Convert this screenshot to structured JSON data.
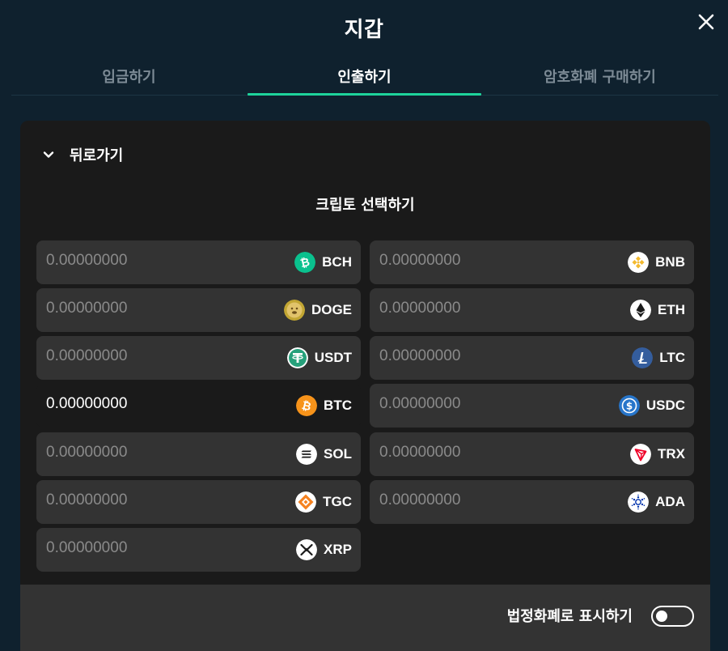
{
  "dialog": {
    "title": "지갑"
  },
  "tabs": [
    {
      "label": "입금하기",
      "active": false
    },
    {
      "label": "인출하기",
      "active": true
    },
    {
      "label": "암호화폐 구매하기",
      "active": false
    }
  ],
  "back": {
    "label": "뒤로가기"
  },
  "section_title": "크립토 선택하기",
  "currencies_left": [
    {
      "amount": "0.00000000",
      "code": "BCH",
      "icon": "bitcoin-cash-icon",
      "color": "#0ac18e"
    },
    {
      "amount": "0.00000000",
      "code": "DOGE",
      "icon": "dogecoin-icon",
      "color": "#c2a633"
    },
    {
      "amount": "0.00000000",
      "code": "USDT",
      "icon": "tether-icon",
      "color": "#26a17b"
    },
    {
      "amount": "0.00000000",
      "code": "BTC",
      "icon": "bitcoin-icon",
      "color": "#f7931a",
      "selected": true
    },
    {
      "amount": "0.00000000",
      "code": "SOL",
      "icon": "solana-icon",
      "color": "#ffffff"
    },
    {
      "amount": "0.00000000",
      "code": "TGC",
      "icon": "tgc-icon",
      "color": "#f58220"
    },
    {
      "amount": "0.00000000",
      "code": "XRP",
      "icon": "xrp-icon",
      "color": "#ffffff"
    }
  ],
  "currencies_right": [
    {
      "amount": "0.00000000",
      "code": "BNB",
      "icon": "binance-coin-icon",
      "color": "#f3ba2f"
    },
    {
      "amount": "0.00000000",
      "code": "ETH",
      "icon": "ethereum-icon",
      "color": "#ffffff"
    },
    {
      "amount": "0.00000000",
      "code": "LTC",
      "icon": "litecoin-icon",
      "color": "#345d9d"
    },
    {
      "amount": "0.00000000",
      "code": "USDC",
      "icon": "usd-coin-icon",
      "color": "#2775ca"
    },
    {
      "amount": "0.00000000",
      "code": "TRX",
      "icon": "tron-icon",
      "color": "#ef0027"
    },
    {
      "amount": "0.00000000",
      "code": "ADA",
      "icon": "cardano-icon",
      "color": "#0033ad"
    }
  ],
  "footer": {
    "fiat_label": "법정화폐로 표시하기",
    "fiat_toggle_on": false
  },
  "colors": {
    "background": "#0f212e",
    "accent": "#1ed39b",
    "panel": "#1a1a1a",
    "cell": "#333333"
  }
}
